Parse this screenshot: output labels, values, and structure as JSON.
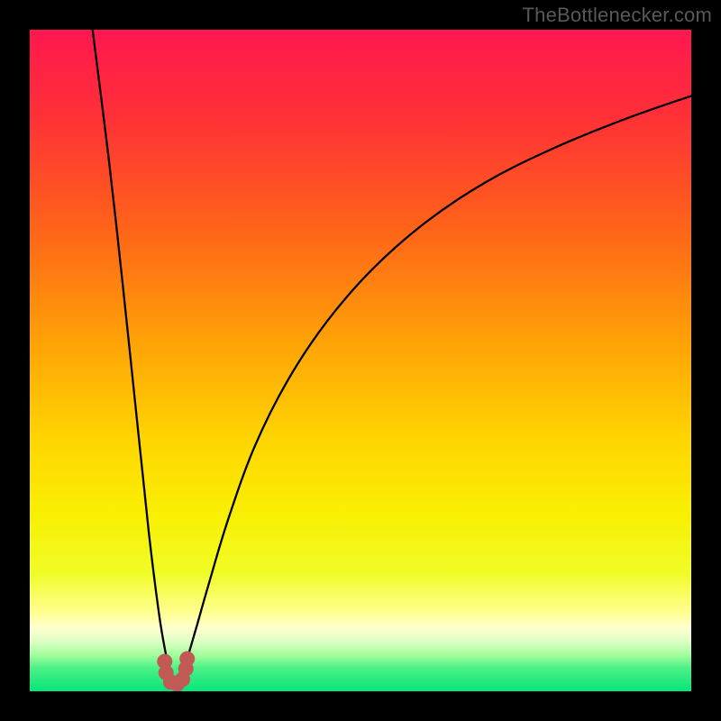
{
  "watermark": "TheBottlenecker.com",
  "gradient": {
    "stops": [
      {
        "offset": 0.0,
        "color": "#ff1750"
      },
      {
        "offset": 0.13,
        "color": "#ff3037"
      },
      {
        "offset": 0.3,
        "color": "#ff6319"
      },
      {
        "offset": 0.48,
        "color": "#ffa506"
      },
      {
        "offset": 0.62,
        "color": "#ffd502"
      },
      {
        "offset": 0.73,
        "color": "#f9ef02"
      },
      {
        "offset": 0.82,
        "color": "#f0fc25"
      },
      {
        "offset": 0.88,
        "color": "#ffff8f"
      },
      {
        "offset": 0.905,
        "color": "#ffffd0"
      },
      {
        "offset": 0.925,
        "color": "#dcffc4"
      },
      {
        "offset": 0.945,
        "color": "#a3ff9c"
      },
      {
        "offset": 0.965,
        "color": "#4cf186"
      },
      {
        "offset": 1.0,
        "color": "#05e57b"
      }
    ]
  },
  "chart_data": {
    "type": "line",
    "title": "",
    "xlabel": "",
    "ylabel": "",
    "xlim": [
      0,
      100
    ],
    "ylim": [
      0,
      100
    ],
    "minimum_x": 22,
    "series": [
      {
        "name": "left-branch",
        "x": [
          9.5,
          12,
          14,
          16,
          18,
          19.5,
          20.5,
          21.2,
          21.8,
          22
        ],
        "values": [
          100,
          80,
          62,
          43,
          24,
          12,
          6,
          3,
          1,
          0.5
        ]
      },
      {
        "name": "right-branch",
        "x": [
          22,
          22.5,
          23.5,
          25,
          27,
          30,
          34,
          39,
          45,
          52,
          60,
          69,
          79,
          90,
          100
        ],
        "values": [
          0.5,
          1.5,
          4,
          9,
          16,
          26,
          37,
          47,
          56,
          64,
          71,
          77,
          82,
          86.5,
          90
        ]
      }
    ],
    "marker": {
      "name": "minimum-marker",
      "color": "#c15a54",
      "points": [
        {
          "x": 20.4,
          "y": 4.5
        },
        {
          "x": 20.6,
          "y": 2.8
        },
        {
          "x": 21.3,
          "y": 1.4
        },
        {
          "x": 22.3,
          "y": 1.1
        },
        {
          "x": 23.1,
          "y": 1.8
        },
        {
          "x": 23.6,
          "y": 3.4
        },
        {
          "x": 23.8,
          "y": 4.9
        }
      ]
    }
  }
}
